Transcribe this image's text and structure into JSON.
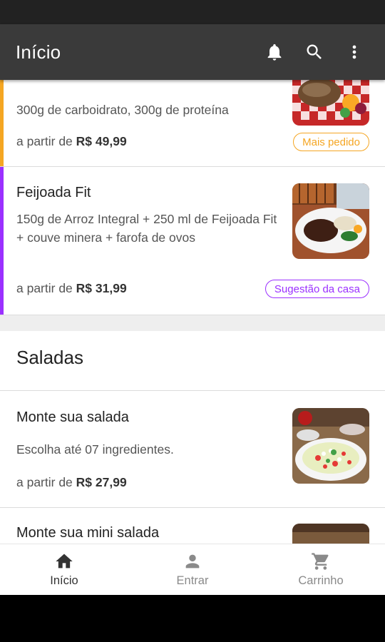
{
  "app_bar": {
    "title": "Início",
    "icons": [
      "bell-icon",
      "search-icon",
      "more-vert-icon"
    ]
  },
  "items": [
    {
      "name": "",
      "description": "300g de carboidrato, 300g de proteína",
      "price_prefix": "a partir de ",
      "price": "R$ 49,99",
      "badge": "Mais pedido",
      "accent_color": "#f5a623",
      "badge_color": "#f5a623"
    },
    {
      "name": "Feijoada Fit",
      "description": "150g de Arroz Integral + 250 ml de Feijoada Fit + couve minera + farofa de ovos",
      "price_prefix": "a partir de ",
      "price": "R$ 31,99",
      "badge": "Sugestão da casa",
      "accent_color": "#9b30ff",
      "badge_color": "#9b30ff"
    }
  ],
  "section": {
    "title": "Saladas"
  },
  "salad_items": [
    {
      "name": "Monte sua salada",
      "description": "Escolha até 07 ingredientes.",
      "price_prefix": "a partir de ",
      "price": "R$ 27,99"
    },
    {
      "name": "Monte sua mini salada"
    }
  ],
  "bottom_nav": [
    {
      "label": "Início",
      "icon": "home-icon",
      "active": true
    },
    {
      "label": "Entrar",
      "icon": "person-icon",
      "active": false
    },
    {
      "label": "Carrinho",
      "icon": "cart-icon",
      "active": false
    }
  ],
  "colors": {
    "app_bar": "#3a3a3a",
    "orange_accent": "#f5a623",
    "purple_accent": "#9b30ff"
  }
}
